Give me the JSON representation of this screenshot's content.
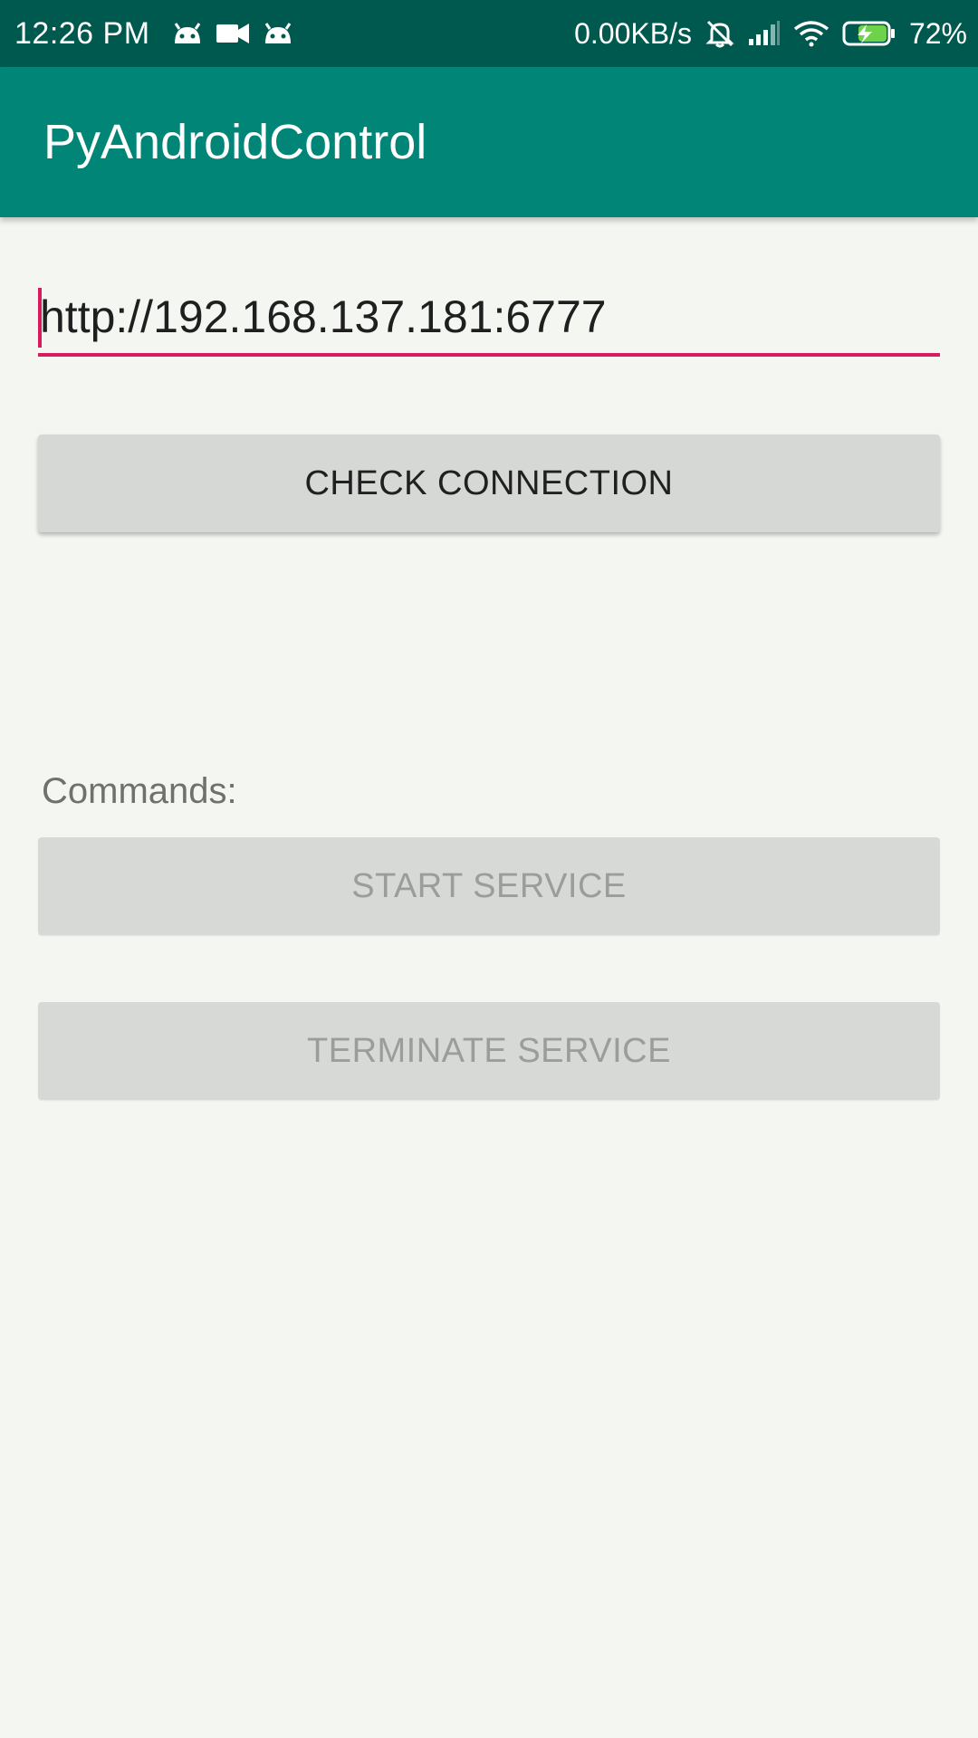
{
  "status_bar": {
    "time": "12:26 PM",
    "network_speed": "0.00KB/s",
    "battery_percent": "72%",
    "icons_left": [
      "android-icon",
      "video-camera-icon",
      "android-icon"
    ],
    "icons_right": [
      "alarm-off-icon",
      "signal-icon",
      "wifi-icon",
      "battery-charging-icon"
    ]
  },
  "app_bar": {
    "title": "PyAndroidControl"
  },
  "url_field": {
    "value": "http://192.168.137.181:6777"
  },
  "buttons": {
    "check_connection": "CHECK CONNECTION",
    "start_service": "START SERVICE",
    "terminate_service": "TERMINATE SERVICE"
  },
  "commands_label": "Commands:",
  "colors": {
    "status_bar": "#00594f",
    "app_bar": "#008577",
    "accent": "#d81b60",
    "background": "#f3f6f1",
    "button": "#d5d8d4"
  }
}
